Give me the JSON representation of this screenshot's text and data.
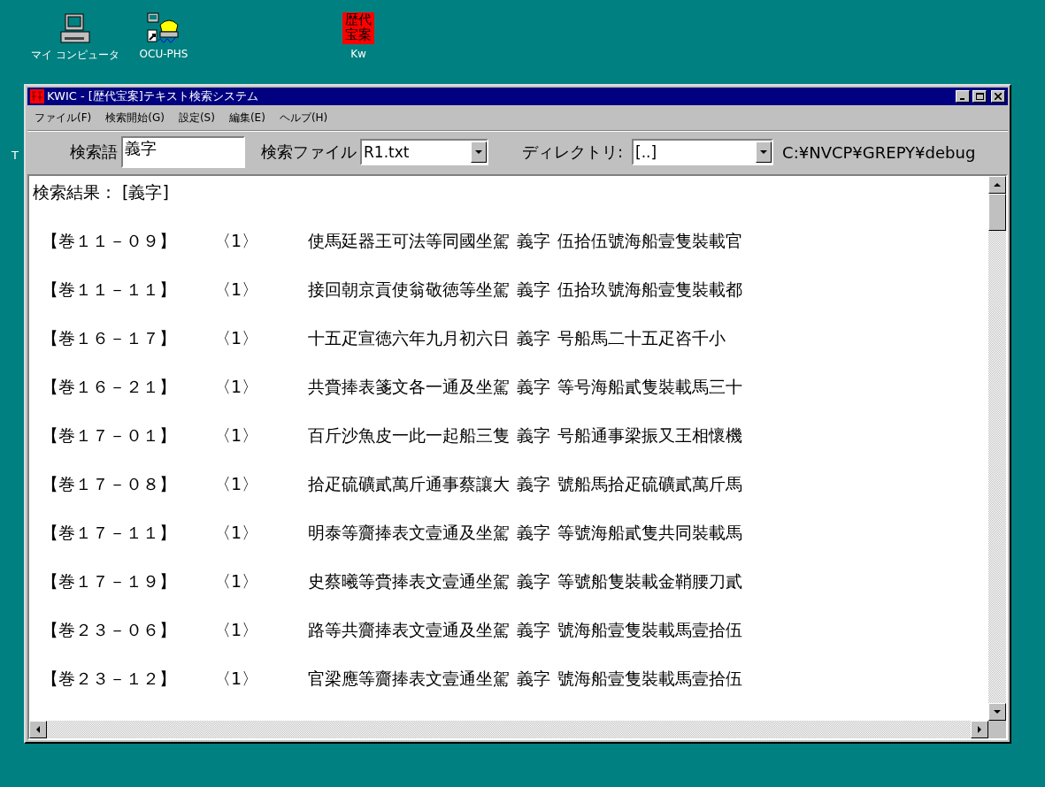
{
  "desktop_icons": [
    {
      "kind": "computer",
      "label": "マイ コンピュータ"
    },
    {
      "kind": "phone",
      "label": "OCU-PHS"
    },
    {
      "kind": "app",
      "label": "Kw",
      "icon_text": "歴代宝案"
    }
  ],
  "desktop_partial_label": "T",
  "window": {
    "title": "KWIC - [歴代宝案]テキスト検索システム",
    "menu": [
      "ファイル(F)",
      "検索開始(G)",
      "設定(S)",
      "編集(E)",
      "ヘルプ(H)"
    ],
    "toolbar": {
      "search_label": "検索語",
      "search_value": "義字",
      "file_label": "検索ファイル",
      "file_value": "R1.txt",
      "dir_label": "ディレクトリ:",
      "dir_value": "[..]",
      "path": "C:¥NVCP¥GREPY¥debug"
    },
    "results": {
      "heading": "検索結果： [義字]",
      "rows": [
        {
          "ref": "【巻１１－０９】",
          "count": "〈1〉",
          "left": "使馬廷器王可法等同國坐駕",
          "keyword": "義字",
          "right": "伍拾伍號海船壹隻裝載官"
        },
        {
          "ref": "【巻１１－１１】",
          "count": "〈1〉",
          "left": "接回朝京貢使翁敬徳等坐駕",
          "keyword": "義字",
          "right": "伍拾玖號海船壹隻裝載都"
        },
        {
          "ref": "【巻１６－１７】",
          "count": "〈1〉",
          "left": "十五疋宣徳六年九月初六日",
          "keyword": "義字",
          "right": "号船馬二十五疋咨千小"
        },
        {
          "ref": "【巻１６－２１】",
          "count": "〈1〉",
          "left": "共賫捧表箋文各一通及坐駕",
          "keyword": "義字",
          "right": "等号海船貳隻裝載馬三十"
        },
        {
          "ref": "【巻１７－０１】",
          "count": "〈1〉",
          "left": "百斤沙魚皮一此一起船三隻",
          "keyword": "義字",
          "right": "号船通事梁振又王相懷機"
        },
        {
          "ref": "【巻１７－０８】",
          "count": "〈1〉",
          "left": "拾疋硫礦貳萬斤通事蔡讓大",
          "keyword": "義字",
          "right": "號船馬拾疋硫礦貳萬斤馬"
        },
        {
          "ref": "【巻１７－１１】",
          "count": "〈1〉",
          "left": "明泰等齎捧表文壹通及坐駕",
          "keyword": "義字",
          "right": "等號海船貳隻共同裝載馬"
        },
        {
          "ref": "【巻１７－１９】",
          "count": "〈1〉",
          "left": "史蔡曦等賫捧表文壹通坐駕",
          "keyword": "義字",
          "right": "等號船隻裝載金鞘腰刀貳"
        },
        {
          "ref": "【巻２３－０６】",
          "count": "〈1〉",
          "left": "路等共齎捧表文壹通及坐駕",
          "keyword": "義字",
          "right": "號海船壹隻裝載馬壹拾伍"
        },
        {
          "ref": "【巻２３－１２】",
          "count": "〈1〉",
          "left": "官梁應等齎捧表文壹通坐駕",
          "keyword": "義字",
          "right": "號海船壹隻裝載馬壹拾伍"
        }
      ]
    }
  }
}
